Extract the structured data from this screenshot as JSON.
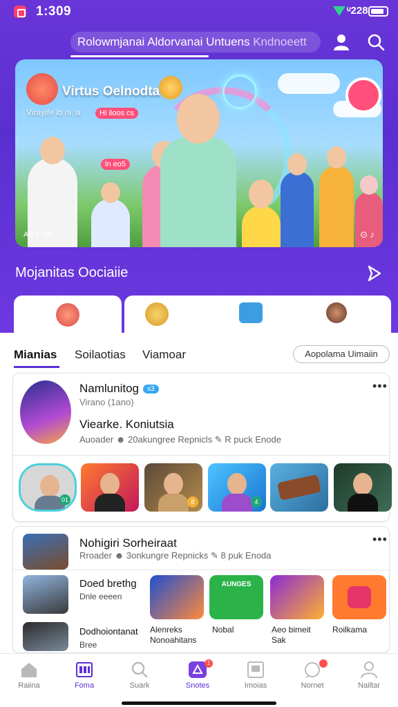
{
  "status": {
    "time": "1:309",
    "network": "ᵘ228"
  },
  "header": {
    "search_text": "Rolowmjanai Aldorvanai Untuens",
    "search_hint": "Kndnoeett"
  },
  "banner": {
    "title": "Virtus Oelnodta",
    "subtitle": "Virayife  lb   ni. a",
    "chip": "Hi iloos cs",
    "chip2": "ln eo5",
    "footer_left": "AB  e nib",
    "footer_right": "⊙ ♪"
  },
  "section": {
    "title": "Mojanitas Oociaiie"
  },
  "tabs": {
    "items": [
      "Mianias",
      "Soilaotias",
      "Viamoar"
    ],
    "button": "Aopolama Uimaiin"
  },
  "card1": {
    "name": "Namlunitog",
    "verified": "s3",
    "sub": "Virano (1ano)",
    "title": "Viearke. Koniutsia",
    "meta": "Auoader  ☻ 20akungree Repnicls  ✎ R puck  Enode",
    "thumb_badges": [
      "01",
      "8",
      "4"
    ]
  },
  "card2": {
    "name": "Nohigiri Sorheiraat",
    "meta": "Rroader  ☻ 3onkungre Repnicks  ✎ 8 puk  Enoda",
    "rows": [
      {
        "title": "Doed brethg",
        "sub": "Dnle eeeen"
      },
      {
        "title": "Dodhoiontanat",
        "sub": "Bree"
      }
    ],
    "tiles": [
      {
        "label": "Alenreks\nNonoahitans"
      },
      {
        "label": "Nobal"
      },
      {
        "label": "Aeo bimeit\nSak"
      },
      {
        "label": "Roilkama"
      }
    ],
    "tile_text": "AUNGES"
  },
  "nav": {
    "items": [
      {
        "label": "Raiina",
        "icon": "home-icon"
      },
      {
        "label": "Foma",
        "icon": "grid-icon"
      },
      {
        "label": "Suark",
        "icon": "search-icon"
      },
      {
        "label": "Snotes",
        "icon": "shape-icon",
        "badge": "1"
      },
      {
        "label": "Imoias",
        "icon": "image-icon"
      },
      {
        "label": "Nornet",
        "icon": "chat-icon",
        "badge": ""
      },
      {
        "label": "Nailtar",
        "icon": "person-icon"
      }
    ]
  },
  "colors": {
    "brand": "#5b2ed6",
    "accent": "#ff4f7a"
  }
}
